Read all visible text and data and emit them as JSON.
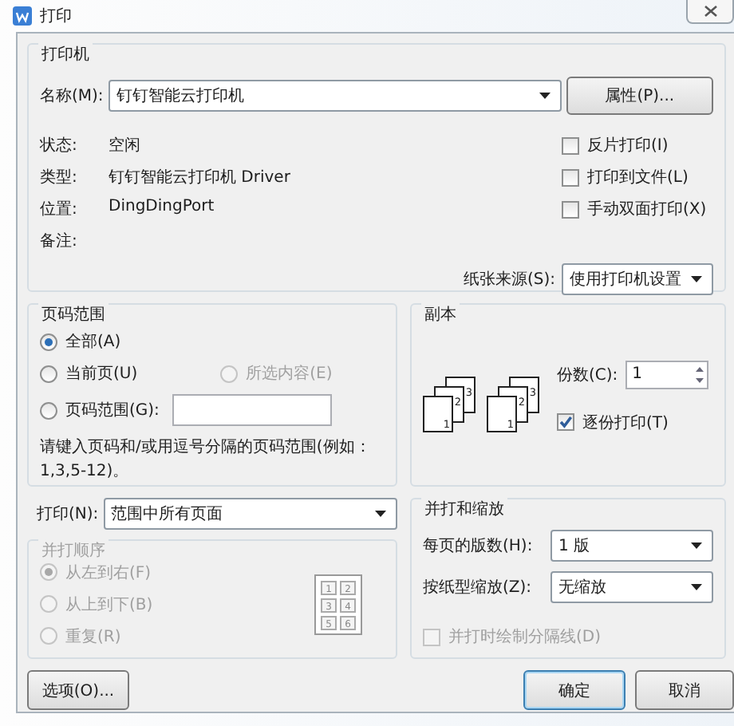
{
  "window": {
    "title": "打印"
  },
  "printer": {
    "legend": "打印机",
    "name_label": "名称(M):",
    "name_value": "钉钉智能云打印机",
    "properties_button": "属性(P)...",
    "info": [
      {
        "label": "状态:",
        "value": "空闲"
      },
      {
        "label": "类型:",
        "value": "钉钉智能云打印机 Driver"
      },
      {
        "label": "位置:",
        "value": "DingDingPort"
      },
      {
        "label": "备注:"
      }
    ],
    "options": [
      {
        "label": "反片打印(I)",
        "checked": false
      },
      {
        "label": "打印到文件(L)",
        "checked": false
      },
      {
        "label": "手动双面打印(X)",
        "checked": false
      }
    ],
    "paper_source_label": "纸张来源(S):",
    "paper_source_value": "使用打印机设置"
  },
  "page_range": {
    "legend": "页码范围",
    "choices": [
      {
        "label": "全部(A)",
        "selected": true,
        "disabled": false
      },
      {
        "label": "当前页(U)",
        "selected": false,
        "disabled": false
      },
      {
        "label": "所选内容(E)",
        "selected": false,
        "disabled": true
      },
      {
        "label": "页码范围(G):",
        "selected": false,
        "disabled": false,
        "kind": "input"
      }
    ],
    "hint": "请键入页码和/或用逗号分隔的页码范围(例如：1,3,5-12)。"
  },
  "copies": {
    "legend": "副本",
    "stacks": [
      {
        "pages": [
          "1",
          "2",
          "3"
        ]
      },
      {
        "pages": [
          "1",
          "2",
          "3"
        ]
      }
    ],
    "count_label": "份数(C):",
    "count": "1",
    "collate_label": "逐份打印(T)",
    "collate": true
  },
  "print_what": {
    "label": "打印(N):",
    "value": "范围中所有页面"
  },
  "order": {
    "legend": "并打顺序",
    "disabled": true,
    "choices": [
      {
        "label": "从左到右(F)",
        "selected": true
      },
      {
        "label": "从上到下(B)",
        "selected": false
      },
      {
        "label": "重复(R)",
        "selected": false
      }
    ],
    "preview_pages": [
      "1",
      "2",
      "3",
      "4",
      "5",
      "6"
    ]
  },
  "scaling": {
    "legend": "并打和缩放",
    "pages_per_sheet_label": "每页的版数(H):",
    "pages_per_sheet": "1 版",
    "scale_label": "按纸型缩放(Z):",
    "scale": "无缩放",
    "borders_label": "并打时绘制分隔线(D)",
    "borders": false,
    "borders_disabled": true
  },
  "buttons": {
    "options": "选项(O)...",
    "ok": "确定",
    "cancel": "取消"
  }
}
